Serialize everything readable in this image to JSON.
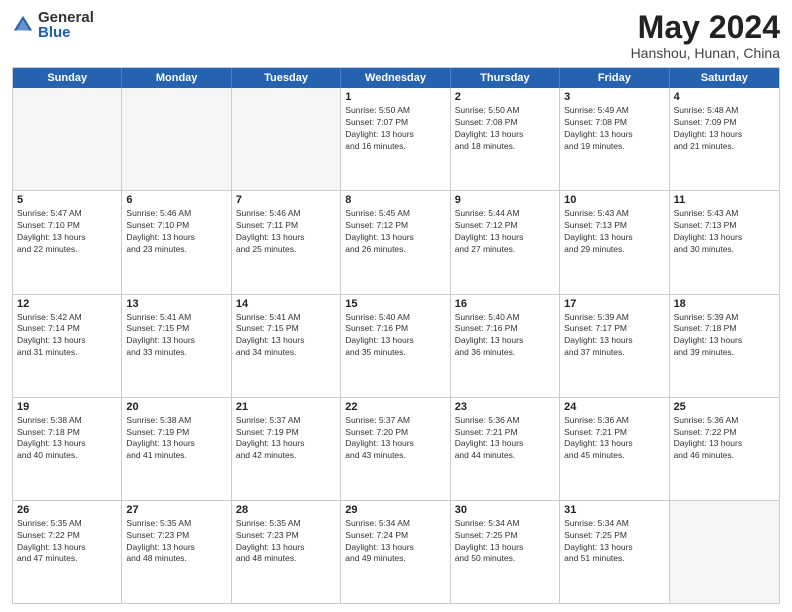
{
  "logo": {
    "general": "General",
    "blue": "Blue"
  },
  "title": "May 2024",
  "location": "Hanshou, Hunan, China",
  "days_of_week": [
    "Sunday",
    "Monday",
    "Tuesday",
    "Wednesday",
    "Thursday",
    "Friday",
    "Saturday"
  ],
  "weeks": [
    [
      {
        "day": "",
        "info": ""
      },
      {
        "day": "",
        "info": ""
      },
      {
        "day": "",
        "info": ""
      },
      {
        "day": "1",
        "info": "Sunrise: 5:50 AM\nSunset: 7:07 PM\nDaylight: 13 hours\nand 16 minutes."
      },
      {
        "day": "2",
        "info": "Sunrise: 5:50 AM\nSunset: 7:08 PM\nDaylight: 13 hours\nand 18 minutes."
      },
      {
        "day": "3",
        "info": "Sunrise: 5:49 AM\nSunset: 7:08 PM\nDaylight: 13 hours\nand 19 minutes."
      },
      {
        "day": "4",
        "info": "Sunrise: 5:48 AM\nSunset: 7:09 PM\nDaylight: 13 hours\nand 21 minutes."
      }
    ],
    [
      {
        "day": "5",
        "info": "Sunrise: 5:47 AM\nSunset: 7:10 PM\nDaylight: 13 hours\nand 22 minutes."
      },
      {
        "day": "6",
        "info": "Sunrise: 5:46 AM\nSunset: 7:10 PM\nDaylight: 13 hours\nand 23 minutes."
      },
      {
        "day": "7",
        "info": "Sunrise: 5:46 AM\nSunset: 7:11 PM\nDaylight: 13 hours\nand 25 minutes."
      },
      {
        "day": "8",
        "info": "Sunrise: 5:45 AM\nSunset: 7:12 PM\nDaylight: 13 hours\nand 26 minutes."
      },
      {
        "day": "9",
        "info": "Sunrise: 5:44 AM\nSunset: 7:12 PM\nDaylight: 13 hours\nand 27 minutes."
      },
      {
        "day": "10",
        "info": "Sunrise: 5:43 AM\nSunset: 7:13 PM\nDaylight: 13 hours\nand 29 minutes."
      },
      {
        "day": "11",
        "info": "Sunrise: 5:43 AM\nSunset: 7:13 PM\nDaylight: 13 hours\nand 30 minutes."
      }
    ],
    [
      {
        "day": "12",
        "info": "Sunrise: 5:42 AM\nSunset: 7:14 PM\nDaylight: 13 hours\nand 31 minutes."
      },
      {
        "day": "13",
        "info": "Sunrise: 5:41 AM\nSunset: 7:15 PM\nDaylight: 13 hours\nand 33 minutes."
      },
      {
        "day": "14",
        "info": "Sunrise: 5:41 AM\nSunset: 7:15 PM\nDaylight: 13 hours\nand 34 minutes."
      },
      {
        "day": "15",
        "info": "Sunrise: 5:40 AM\nSunset: 7:16 PM\nDaylight: 13 hours\nand 35 minutes."
      },
      {
        "day": "16",
        "info": "Sunrise: 5:40 AM\nSunset: 7:16 PM\nDaylight: 13 hours\nand 36 minutes."
      },
      {
        "day": "17",
        "info": "Sunrise: 5:39 AM\nSunset: 7:17 PM\nDaylight: 13 hours\nand 37 minutes."
      },
      {
        "day": "18",
        "info": "Sunrise: 5:39 AM\nSunset: 7:18 PM\nDaylight: 13 hours\nand 39 minutes."
      }
    ],
    [
      {
        "day": "19",
        "info": "Sunrise: 5:38 AM\nSunset: 7:18 PM\nDaylight: 13 hours\nand 40 minutes."
      },
      {
        "day": "20",
        "info": "Sunrise: 5:38 AM\nSunset: 7:19 PM\nDaylight: 13 hours\nand 41 minutes."
      },
      {
        "day": "21",
        "info": "Sunrise: 5:37 AM\nSunset: 7:19 PM\nDaylight: 13 hours\nand 42 minutes."
      },
      {
        "day": "22",
        "info": "Sunrise: 5:37 AM\nSunset: 7:20 PM\nDaylight: 13 hours\nand 43 minutes."
      },
      {
        "day": "23",
        "info": "Sunrise: 5:36 AM\nSunset: 7:21 PM\nDaylight: 13 hours\nand 44 minutes."
      },
      {
        "day": "24",
        "info": "Sunrise: 5:36 AM\nSunset: 7:21 PM\nDaylight: 13 hours\nand 45 minutes."
      },
      {
        "day": "25",
        "info": "Sunrise: 5:36 AM\nSunset: 7:22 PM\nDaylight: 13 hours\nand 46 minutes."
      }
    ],
    [
      {
        "day": "26",
        "info": "Sunrise: 5:35 AM\nSunset: 7:22 PM\nDaylight: 13 hours\nand 47 minutes."
      },
      {
        "day": "27",
        "info": "Sunrise: 5:35 AM\nSunset: 7:23 PM\nDaylight: 13 hours\nand 48 minutes."
      },
      {
        "day": "28",
        "info": "Sunrise: 5:35 AM\nSunset: 7:23 PM\nDaylight: 13 hours\nand 48 minutes."
      },
      {
        "day": "29",
        "info": "Sunrise: 5:34 AM\nSunset: 7:24 PM\nDaylight: 13 hours\nand 49 minutes."
      },
      {
        "day": "30",
        "info": "Sunrise: 5:34 AM\nSunset: 7:25 PM\nDaylight: 13 hours\nand 50 minutes."
      },
      {
        "day": "31",
        "info": "Sunrise: 5:34 AM\nSunset: 7:25 PM\nDaylight: 13 hours\nand 51 minutes."
      },
      {
        "day": "",
        "info": ""
      }
    ]
  ]
}
